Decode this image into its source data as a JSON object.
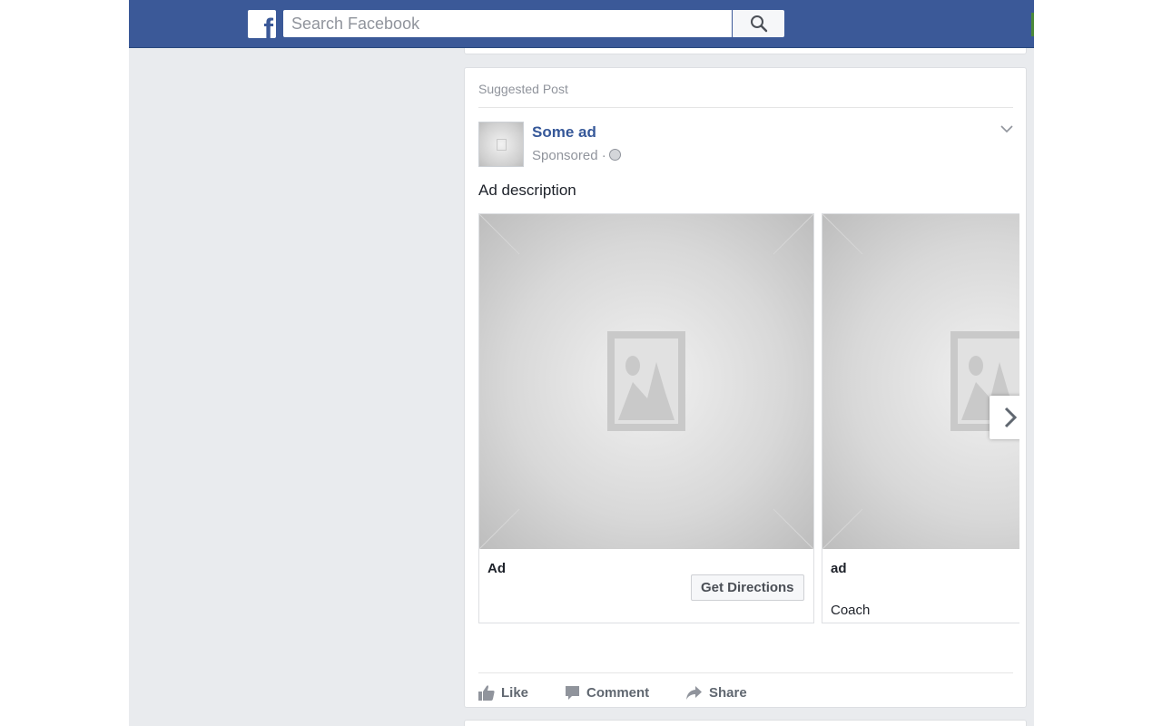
{
  "header": {
    "logo_letter": "f",
    "search": {
      "placeholder": "Search Facebook",
      "value": ""
    },
    "brand_color": "#3b5998",
    "icons": [
      "facebook-logo-icon",
      "search-icon"
    ]
  },
  "post": {
    "label": "Suggested Post",
    "page_name": "Some ad",
    "meta": "Sponsored ·",
    "meta_icon": "globe-icon",
    "menu_icon": "chevron-down-icon",
    "text": "Ad description",
    "carousel": {
      "next_icon": "chevron-right-icon",
      "items": [
        {
          "title": "Ad",
          "button": "Get Directions",
          "subtitle": ""
        },
        {
          "title": "ad",
          "button": "",
          "subtitle": "Coach"
        }
      ]
    },
    "actions": [
      {
        "label": "Like",
        "icon": "like-icon"
      },
      {
        "label": "Comment",
        "icon": "comment-icon"
      },
      {
        "label": "Share",
        "icon": "share-icon"
      }
    ]
  }
}
